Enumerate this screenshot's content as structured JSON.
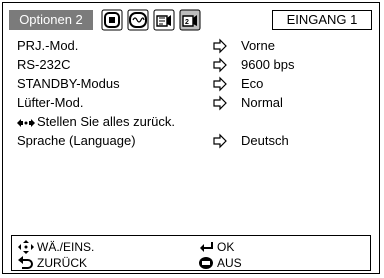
{
  "header": {
    "active_tab": "Optionen 2",
    "input_label": "EINGANG 1",
    "tab_icons": [
      "picture-tab-icon",
      "sync-tab-icon",
      "options1-tab-icon",
      "options2-tab-icon"
    ]
  },
  "menu": {
    "rows": [
      {
        "label": "PRJ.-Mod.",
        "value": "Vorne",
        "icon": "arrow-right-icon"
      },
      {
        "label": "RS-232C",
        "value": "9600 bps",
        "icon": "arrow-right-icon"
      },
      {
        "label": "STANDBY-Modus",
        "value": "Eco",
        "icon": "arrow-right-icon"
      },
      {
        "label": "Lüfter-Mod.",
        "value": "Normal",
        "icon": "arrow-right-icon"
      },
      {
        "label": "Stellen Sie alles zurück.",
        "icon": "reset-icon"
      },
      {
        "label": "Sprache (Language)",
        "value": "Deutsch",
        "icon": "arrow-right-icon"
      }
    ]
  },
  "footer": {
    "select_label": "WÄ./EINS.",
    "ok_label": "OK",
    "back_label": "ZURÜCK",
    "off_label": "AUS"
  }
}
